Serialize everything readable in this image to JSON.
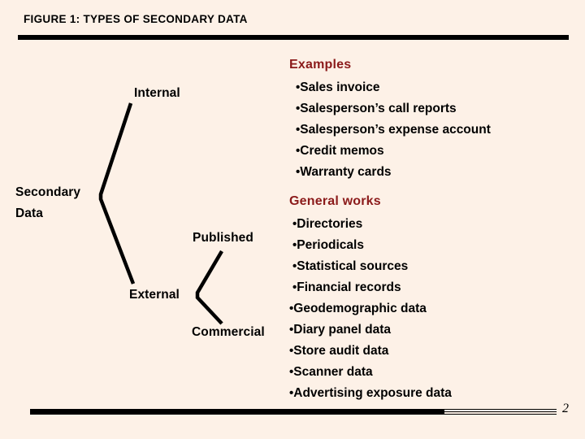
{
  "slide": {
    "title": "FIGURE 1: TYPES OF SECONDARY DATA",
    "page_number": "2",
    "background_color": "#fdf1e7",
    "rule_color": "#000000",
    "heading_color": "#8b1a1a",
    "text_color": "#000000"
  },
  "tree": {
    "root": "Secondary",
    "root_line2": "Data",
    "internal": "Internal",
    "external": "External",
    "published": "Published",
    "commercial": "Commercial"
  },
  "lists": [
    {
      "heading": "Examples",
      "bullet": "•",
      "items": [
        "Sales invoice",
        "Salesperson’s call reports",
        "Salesperson’s expense account",
        "Credit memos",
        "Warranty cards"
      ]
    },
    {
      "heading": "General works",
      "bullet": "•",
      "items": [
        "Directories",
        "Periodicals",
        "Statistical sources",
        "Financial records",
        "Geodemographic data",
        "Diary panel data",
        "Store audit data",
        "Scanner data",
        "Advertising exposure data"
      ]
    }
  ]
}
